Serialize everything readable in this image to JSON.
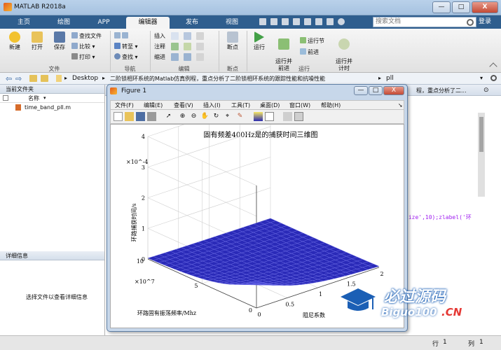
{
  "app": {
    "title": "MATLAB R2018a"
  },
  "window_controls": {
    "minimize": "—",
    "maximize": "□",
    "close": "X"
  },
  "tabs": [
    {
      "label": "主页"
    },
    {
      "label": "绘图"
    },
    {
      "label": "APP"
    },
    {
      "label": "编辑器"
    },
    {
      "label": "发布"
    },
    {
      "label": "视图"
    }
  ],
  "search": {
    "placeholder": "搜索文档"
  },
  "login": "登录",
  "ribbon": {
    "file": {
      "new": "新建",
      "open": "打开",
      "save": "保存",
      "find_files": "查找文件",
      "compare": "比较",
      "print": "打印",
      "group": "文件"
    },
    "nav": {
      "goto": "转至",
      "find": "查找",
      "group": "导航"
    },
    "edit": {
      "insert": "插入",
      "comment": "注释",
      "indent": "缩进",
      "group": "编辑"
    },
    "breakpoints": {
      "label": "断点",
      "group": "断点"
    },
    "run": {
      "run": "运行",
      "run_advance": "运行并\n前进",
      "run_section": "运行节",
      "advance": "前进",
      "run_time": "运行并\n计时",
      "group": "运行"
    }
  },
  "address": {
    "path": [
      "Desktop",
      "二阶锁相环系统的Matlab仿真例程，重点分析了二阶锁相环系统的跟踪性能和抗噪性能",
      "pll"
    ]
  },
  "current_folder": {
    "title": "当前文件夹",
    "col_name": "名称",
    "files": [
      "time_band_pll.m"
    ]
  },
  "details": {
    "title": "详细信息",
    "hint": "选择文件以查看详细信息"
  },
  "editor": {
    "tail_title": "程，重点分析了二...",
    "code_fragment": "size',10);zlabel('环"
  },
  "status": {
    "row_label": "行",
    "row": "1",
    "col_label": "列",
    "col": "1"
  },
  "figure": {
    "title": "Figure 1",
    "menu": [
      "文件(F)",
      "编辑(E)",
      "查看(V)",
      "插入(I)",
      "工具(T)",
      "桌面(D)",
      "窗口(W)",
      "帮助(H)"
    ],
    "tool_icons": [
      "new-figure-icon",
      "open-icon",
      "save-icon",
      "print-icon",
      "pointer-icon",
      "zoom-in-icon",
      "zoom-out-icon",
      "pan-icon",
      "rotate-icon",
      "data-cursor-icon",
      "brush-icon",
      "colorbar-icon",
      "legend-icon",
      "hide-plot-tools-icon",
      "show-plot-tools-icon"
    ]
  },
  "chart_data": {
    "type": "surface",
    "title": "固有频差400Hz是的捕获时间三维图",
    "xlabel": "阻尼系数",
    "ylabel": "环路固有振荡频率/Mhz",
    "zlabel": "环路捕获时间/s",
    "x_ticks": [
      "0",
      "0.5",
      "1",
      "1.5",
      "2"
    ],
    "y_ticks": [
      "0",
      "5",
      "10"
    ],
    "y_exponent": "×10^7",
    "z_ticks": [
      "0",
      "1",
      "2",
      "3",
      "4"
    ],
    "z_exponent": "×10^-4",
    "xlim": [
      0,
      2
    ],
    "ylim": [
      0,
      10
    ],
    "zlim": [
      0,
      4
    ],
    "note": "surface mostly near 0, rising sharply (~3.3e-4) near x→0 and small y",
    "colors": {
      "low": "#1a1aa6",
      "mid": "#3a3ad0",
      "high": "#f5e663"
    }
  },
  "watermark": {
    "cn": "必过源码",
    "url_a": "Biguo100",
    "url_b": ".CN"
  }
}
